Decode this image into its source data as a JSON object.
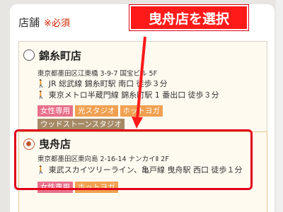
{
  "field": {
    "label": "店舗",
    "required": "※必須"
  },
  "stores": [
    {
      "name": "錦糸町店",
      "address": "東京都墨田区江東橋 3-9-7 国宝ビル 5F",
      "access": [
        "JR 総武線 錦糸町駅 南口 徒歩３分",
        "東京メトロ半蔵門線 錦糸町駅 1 番出口 徒歩３分"
      ],
      "tags": [
        "女性専用",
        "光スタジオ",
        "ホットヨガ",
        "ウッドストーンスタジオ"
      ],
      "selected": false
    },
    {
      "name": "曳舟店",
      "address": "東京都墨田区東向島 2-16-14 ナンカイⅡ 2F",
      "access": [
        "東武スカイツリーライン、亀戸線 曳舟駅 西口 徒歩１分"
      ],
      "tags": [
        "女性専用",
        "ホットヨガ"
      ],
      "selected": true
    }
  ],
  "callout": "曳舟店を選択",
  "colors": {
    "highlight": "#e0001a",
    "tag_pink": "#e8708a",
    "tag_orange": "#f0a050",
    "tag_brown": "#a68a66"
  },
  "icons": {
    "walk": "walking-person-icon"
  }
}
